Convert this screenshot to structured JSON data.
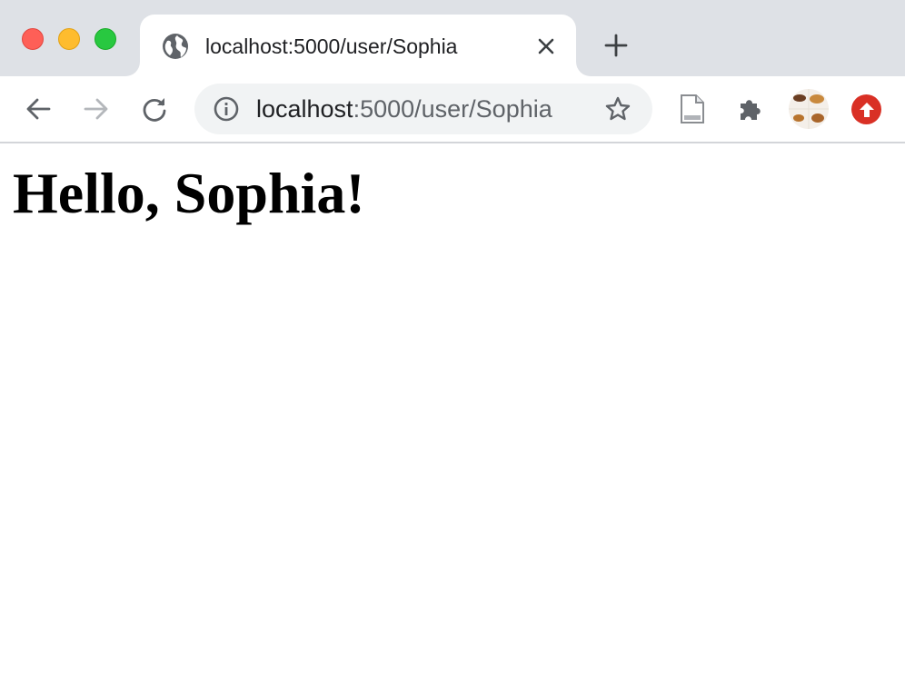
{
  "browser": {
    "tab": {
      "title": "localhost:5000/user/Sophia",
      "favicon": "globe-icon"
    },
    "address_bar": {
      "host": "localhost",
      "path": ":5000/user/Sophia"
    },
    "colors": {
      "tabstrip_bg": "#dee1e6",
      "omnibox_bg": "#f1f3f4",
      "update_badge": "#d93025",
      "traffic_close": "#fe5f57",
      "traffic_minimize": "#febc2e",
      "traffic_maximize": "#28c840"
    },
    "toolbar_icons": [
      "back-arrow-icon",
      "forward-arrow-icon",
      "reload-icon",
      "info-icon",
      "star-icon",
      "document-icon",
      "puzzle-icon",
      "avatar",
      "update-icon"
    ]
  },
  "page": {
    "heading": "Hello, Sophia!"
  }
}
